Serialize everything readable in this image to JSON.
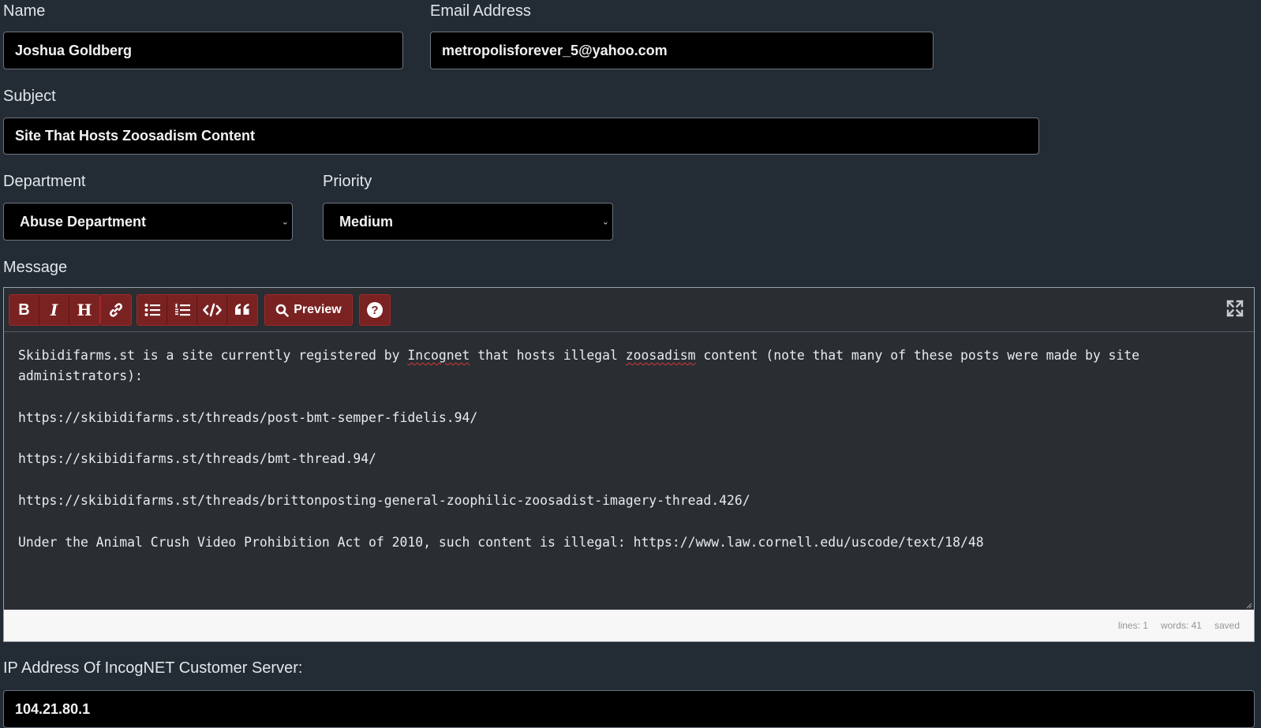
{
  "form": {
    "name_label": "Name",
    "name_value": "Joshua Goldberg",
    "email_label": "Email Address",
    "email_value": "metropolisforever_5@yahoo.com",
    "subject_label": "Subject",
    "subject_value": "Site That Hosts Zoosadism Content",
    "department_label": "Department",
    "department_value": "Abuse Department",
    "priority_label": "Priority",
    "priority_value": "Medium",
    "message_label": "Message",
    "ip_label": "IP Address Of IncogNET Customer Server:",
    "ip_value": "104.21.80.1"
  },
  "toolbar": {
    "bold": "B",
    "italic": "I",
    "heading": "H",
    "preview_label": "Preview",
    "help": "?",
    "icons": [
      "bold-icon",
      "italic-icon",
      "heading-icon",
      "link-icon",
      "unordered-list-icon",
      "ordered-list-icon",
      "code-icon",
      "quote-icon",
      "search-icon",
      "help-icon",
      "fullscreen-icon"
    ]
  },
  "message": {
    "line1_a": "Skibidifarms.st is a site currently registered by ",
    "line1_b": "Incognet",
    "line1_c": " that hosts illegal ",
    "line1_d": "zoosadism",
    "line1_e": " content (note that many of these posts were made by site administrators):",
    "url1": "https://skibidifarms.st/threads/post-bmt-semper-fidelis.94/",
    "url2": "https://skibidifarms.st/threads/bmt-thread.94/",
    "url3": "https://skibidifarms.st/threads/brittonposting-general-zoophilic-zoosadist-imagery-thread.426/",
    "last_line": "Under the Animal Crush Video Prohibition Act of 2010, such content is illegal: https://www.law.cornell.edu/uscode/text/18/48"
  },
  "status": {
    "lines": "lines: 1",
    "words": "words: 41",
    "saved": "saved"
  },
  "colors": {
    "background": "#232b35",
    "button": "#7a2222",
    "field": "#000000"
  }
}
